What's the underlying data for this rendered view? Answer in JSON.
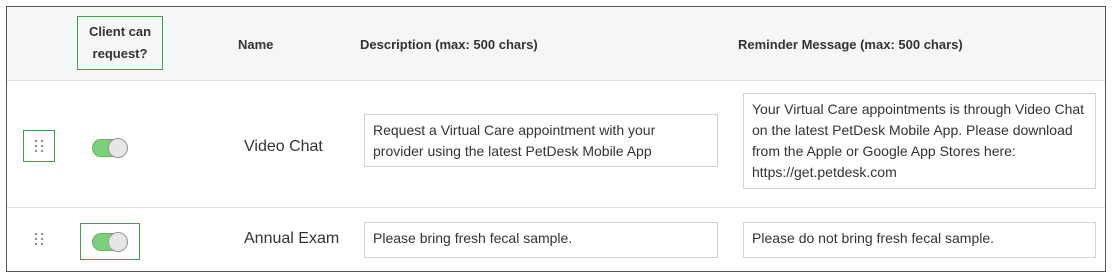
{
  "header": {
    "client_can_request_line1": "Client can",
    "client_can_request_line2": "request?",
    "name": "Name",
    "description": "Description (max: 500 chars)",
    "reminder": "Reminder Message (max: 500 chars)"
  },
  "rows": [
    {
      "name": "Video Chat",
      "client_can_request": true,
      "description": "Request a Virtual Care appointment with your provider using the latest PetDesk Mobile App",
      "reminder": "Your Virtual Care appointments is through Video Chat on the latest PetDesk Mobile App. Please download from the Apple or Google App Stores here: https://get.petdesk.com"
    },
    {
      "name": "Annual Exam",
      "client_can_request": true,
      "description": "Please bring fresh fecal sample.",
      "reminder": "Please do not bring fresh fecal sample."
    }
  ],
  "colors": {
    "toggle_on": "#7cd07c",
    "highlight_border": "#3aa34a",
    "header_bg": "#f5f6f8"
  },
  "icons": {
    "drag_handle": "drag-handle-icon"
  }
}
